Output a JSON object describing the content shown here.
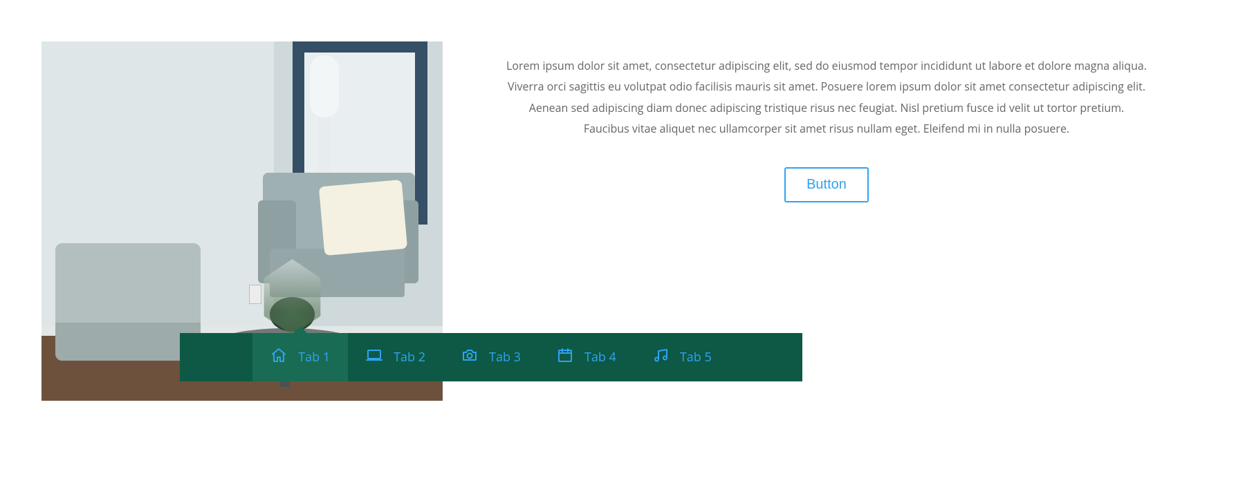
{
  "content": {
    "description": "Lorem ipsum dolor sit amet, consectetur adipiscing elit, sed do eiusmod tempor incididunt ut labore et dolore magna aliqua. Viverra orci sagittis eu volutpat odio facilisis mauris sit amet. Posuere lorem ipsum dolor sit amet consectetur adipiscing elit. Aenean sed adipiscing diam donec adipiscing tristique risus nec feugiat. Nisl pretium fusce id velit ut tortor pretium. Faucibus vitae aliquet nec ullamcorper sit amet risus nullam eget. Eleifend mi in nulla posuere.",
    "button_label": "Button"
  },
  "tabs": [
    {
      "label": "Tab 1",
      "icon": "home-icon",
      "active": true
    },
    {
      "label": "Tab 2",
      "icon": "laptop-icon",
      "active": false
    },
    {
      "label": "Tab 3",
      "icon": "camera-icon",
      "active": false
    },
    {
      "label": "Tab 4",
      "icon": "calendar-icon",
      "active": false
    },
    {
      "label": "Tab 5",
      "icon": "music-icon",
      "active": false
    }
  ],
  "colors": {
    "accent": "#2ea3f2",
    "tabbar_bg": "#0e5945",
    "tab_active_bg": "#1a6b54",
    "text": "#666666"
  },
  "image": {
    "alt": "Modern living room corner with grey armchair, ottoman, framed art and side table"
  }
}
